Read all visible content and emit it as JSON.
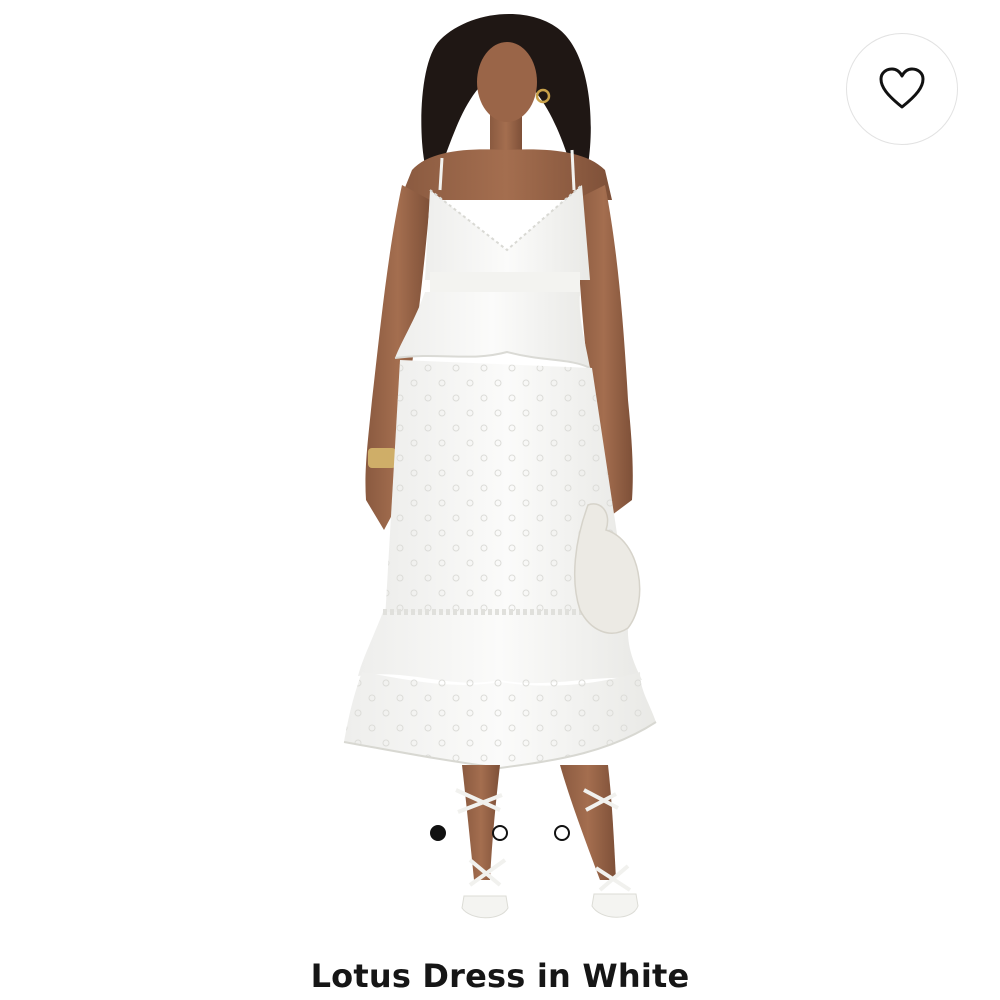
{
  "product": {
    "title": "Lotus Dress in White",
    "image_alt": "Model wearing white eyelet midi dress with ruffle tiers"
  },
  "wishlist": {
    "icon": "heart-outline-icon"
  },
  "carousel": {
    "total_images": 3,
    "active_index": 0
  },
  "colors": {
    "text": "#161616",
    "dot": "#111111",
    "border": "#e2e2e2",
    "background": "#ffffff"
  }
}
